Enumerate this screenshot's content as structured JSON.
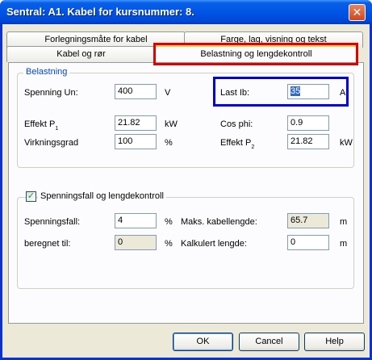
{
  "window": {
    "title": "Sentral: A1. Kabel for kursnummer: 8.",
    "close_glyph": "✕"
  },
  "tabs": {
    "row1": [
      "Forlegningsmåte for kabel",
      "Farge, lag, visning og tekst"
    ],
    "row2": [
      "Kabel og rør",
      "Belastning og lengdekontroll"
    ],
    "active": "Belastning og lengdekontroll"
  },
  "belastning": {
    "group_title": "Belastning",
    "spenning": {
      "label": "Spenning Un:",
      "value": "400",
      "unit": "V"
    },
    "last": {
      "label": "Last Ib:",
      "value": "35",
      "unit": "A"
    },
    "effekt1": {
      "label": "Effekt P",
      "sub": "1",
      "value": "21.82",
      "unit": "kW"
    },
    "cosphi": {
      "label": "Cos phi:",
      "value": "0.9"
    },
    "virkningsgrad": {
      "label": "Virkningsgrad",
      "value": "100",
      "unit": "%"
    },
    "effekt2": {
      "label": "Effekt P",
      "sub": "2",
      "value": "21.82",
      "unit": "kW"
    }
  },
  "spenningsfall": {
    "checkbox_label": "Spenningsfall og lengdekontroll",
    "checked": true,
    "spenningsfall": {
      "label": "Spenningsfall:",
      "value": "4",
      "unit": "%"
    },
    "maks": {
      "label": "Maks. kabellengde:",
      "value": "65.7",
      "unit": "m"
    },
    "beregnet": {
      "label": "beregnet til:",
      "value": "0",
      "unit": "%"
    },
    "kalkulert": {
      "label": "Kalkulert lengde:",
      "value": "0",
      "unit": "m"
    }
  },
  "buttons": {
    "ok": "OK",
    "cancel": "Cancel",
    "help": "Help"
  },
  "colors": {
    "highlight_tab": "#e00000",
    "highlight_field": "#0000d8"
  }
}
